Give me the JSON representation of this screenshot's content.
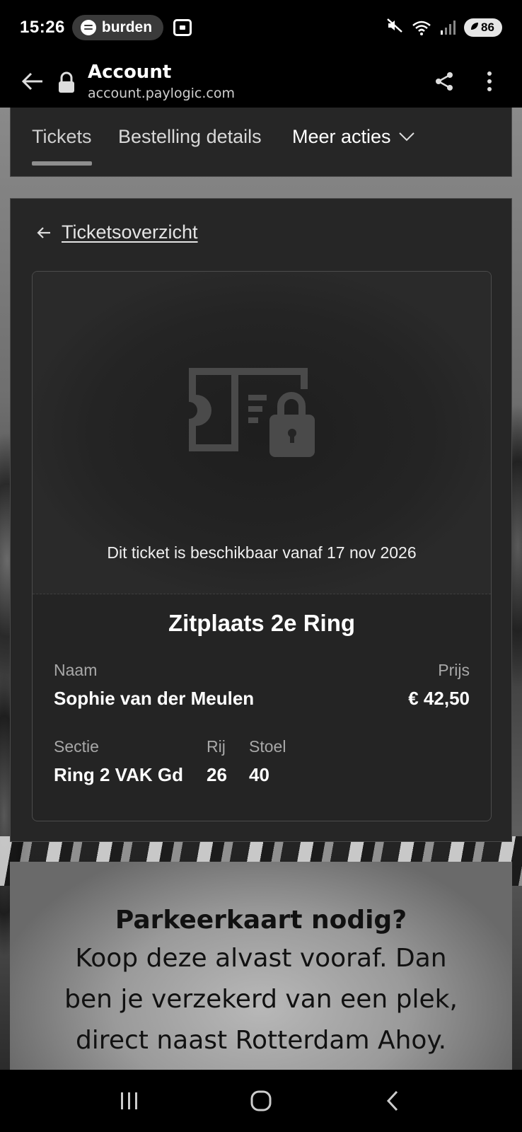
{
  "status_bar": {
    "time": "15:26",
    "media_app_icon": "spotify-icon",
    "media_title": "burden",
    "battery_level": "86"
  },
  "browser": {
    "page_title": "Account",
    "url": "account.paylogic.com"
  },
  "tabs": [
    {
      "label": "Tickets",
      "active": true
    },
    {
      "label": "Bestelling details",
      "active": false
    },
    {
      "label": "Meer acties",
      "active": false
    }
  ],
  "ticket": {
    "back_link_label": "Ticketsoverzicht",
    "availability_text": "Dit ticket is beschikbaar vanaf 17 nov 2026",
    "title": "Zitplaats 2e Ring",
    "name_label": "Naam",
    "name_value": "Sophie van der Meulen",
    "price_label": "Prijs",
    "price_value": "€ 42,50",
    "section_label": "Sectie",
    "section_value": "Ring 2 VAK Gd",
    "row_label": "Rij",
    "row_value": "26",
    "seat_label": "Stoel",
    "seat_value": "40"
  },
  "ad": {
    "heading": "Parkeerkaart nodig?",
    "body_lines": [
      "Koop deze alvast vooraf. Dan",
      "ben je verzekerd van een plek,",
      "direct naast Rotterdam Ahoy."
    ]
  }
}
